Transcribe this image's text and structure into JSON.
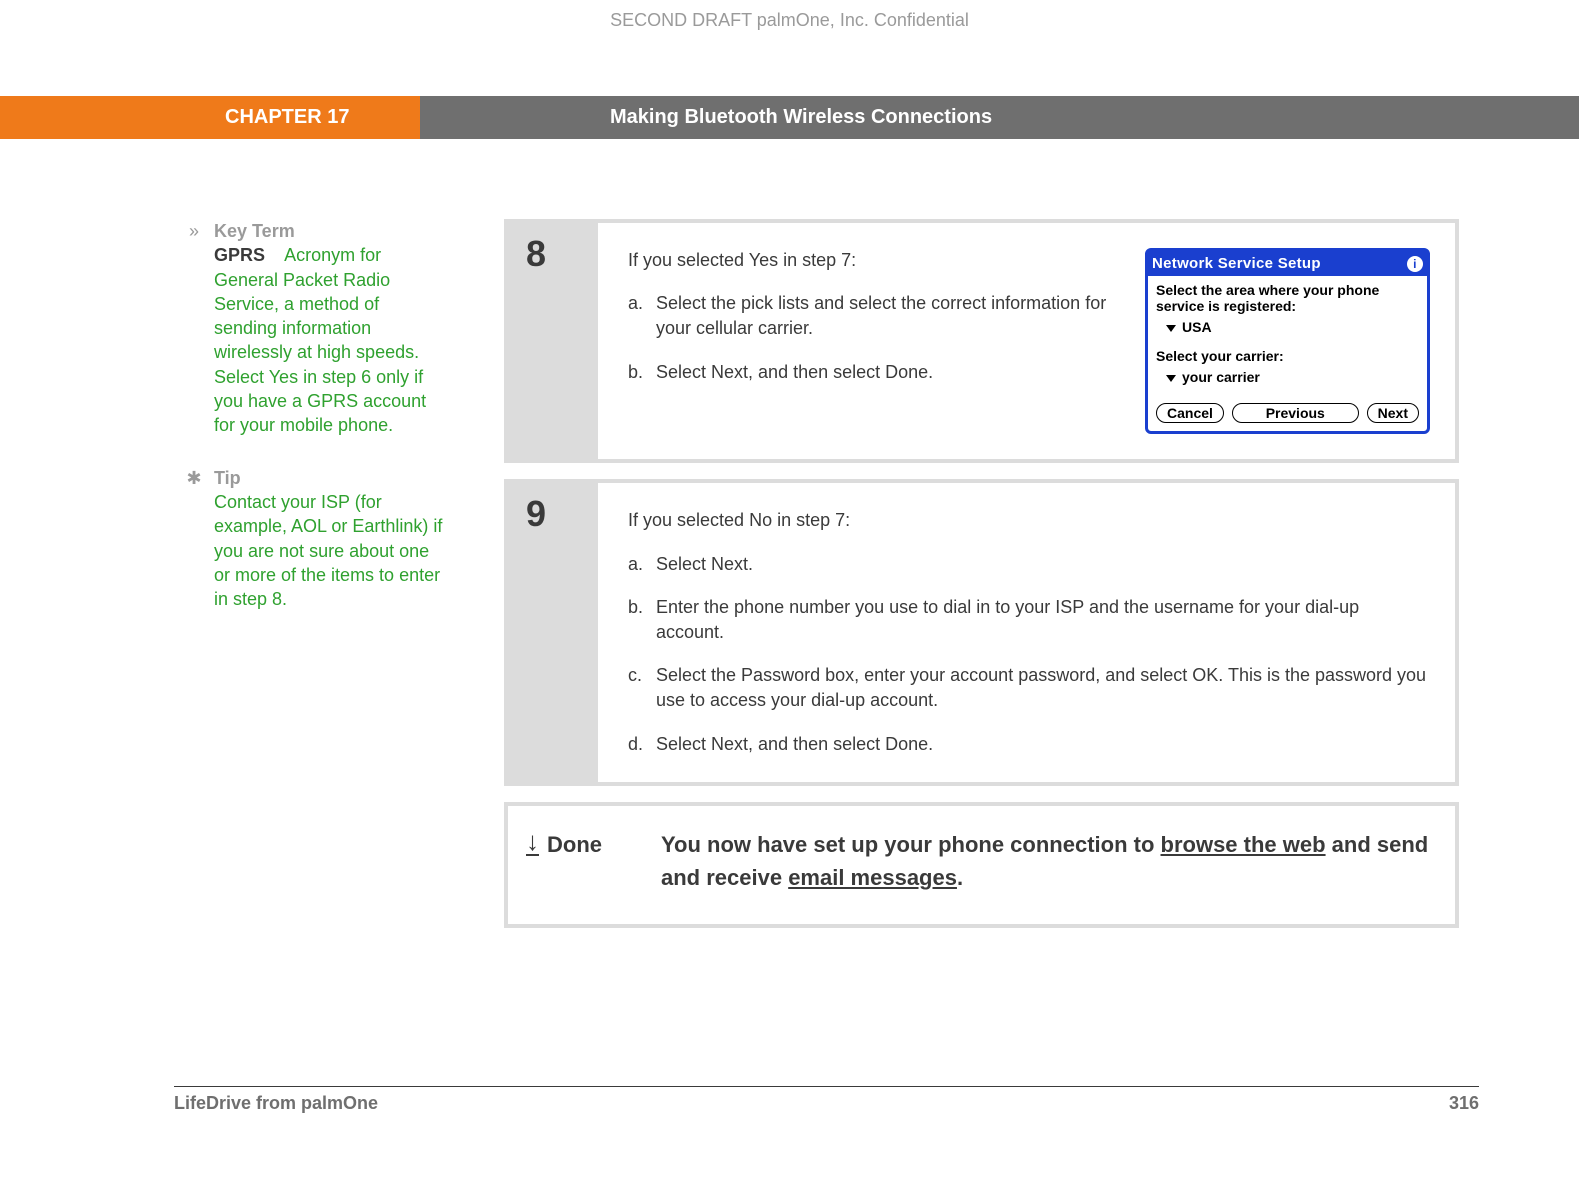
{
  "confidential": "SECOND DRAFT palmOne, Inc.  Confidential",
  "header": {
    "chapter": "CHAPTER 17",
    "title": "Making Bluetooth Wireless Connections"
  },
  "sidebar": {
    "keyterm": {
      "heading": "Key Term",
      "term": "GPRS",
      "body": "Acronym for General Packet Radio Service, a method of sending information wirelessly at high speeds. Select Yes in step 6 only if you have a GPRS account for your mobile phone."
    },
    "tip": {
      "heading": "Tip",
      "body": "Contact your ISP (for example, AOL or Earthlink) if you are not sure about one or more of the items to enter in step 8."
    }
  },
  "step8": {
    "num": "8",
    "intro": "If you selected Yes in step 7:",
    "a_letter": "a.",
    "a_text": "Select the pick lists and select the correct information for your cellular carrier.",
    "b_letter": "b.",
    "b_text": "Select Next, and then select Done."
  },
  "palm": {
    "title": "Network Service Setup",
    "line1": "Select the area where your phone service is registered:",
    "pick1": "USA",
    "line2": "Select your carrier:",
    "pick2": "your carrier",
    "cancel": "Cancel",
    "previous": "Previous",
    "next": "Next"
  },
  "step9": {
    "num": "9",
    "intro": "If you selected No in step 7:",
    "a_letter": "a.",
    "a_text": "Select Next.",
    "b_letter": "b.",
    "b_text": "Enter the phone number you use to dial in to your ISP and the username for your dial-up account.",
    "c_letter": "c.",
    "c_text": "Select the Password box, enter your account password, and select OK. This is the password you use to access your dial-up account.",
    "d_letter": "d.",
    "d_text": "Select Next, and then select Done."
  },
  "done": {
    "label": "Done",
    "text1": "You now have set up your phone connection to ",
    "link1": "browse the web",
    "text2": " and send and receive ",
    "link2": "email messages",
    "text3": "."
  },
  "footer": {
    "left": "LifeDrive from palmOne",
    "right": "316"
  }
}
